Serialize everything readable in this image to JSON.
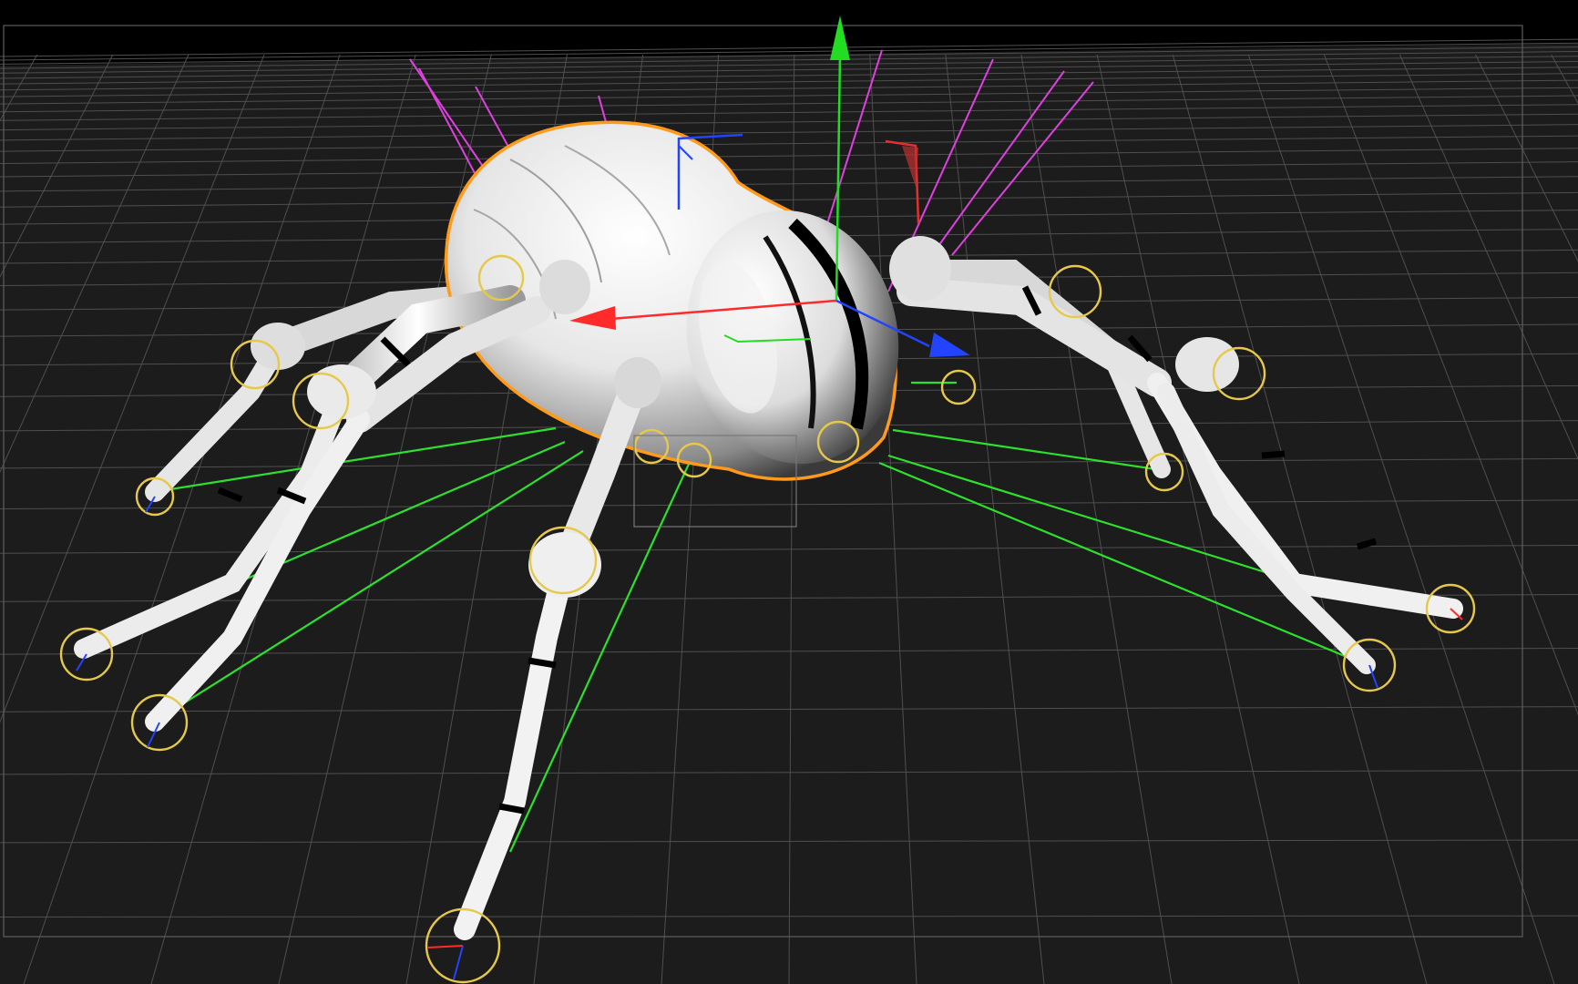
{
  "viewport": {
    "view": "perspective",
    "shading": "white-shaded",
    "grid_visible": true,
    "selection": "abdomen-mesh",
    "colors": {
      "background": "#000000",
      "floor": "#1c1c1c",
      "grid_line": "#5a5a5a",
      "selection_outline": "#ff9a1a",
      "ik_target": "#e6c84a",
      "ik_line": "#2ee02e",
      "pole_vector": "#e040e0",
      "axis_x": "#ff2a2a",
      "axis_y": "#22dd22",
      "axis_z": "#2244ff"
    }
  },
  "scene": {
    "object": "spider-rig",
    "leg_count": 8,
    "gizmo": {
      "type": "move",
      "axes": [
        "x",
        "y",
        "z"
      ]
    },
    "icons": [
      "move-gizmo-icon",
      "ik-target-icon",
      "pole-vector-icon"
    ]
  }
}
